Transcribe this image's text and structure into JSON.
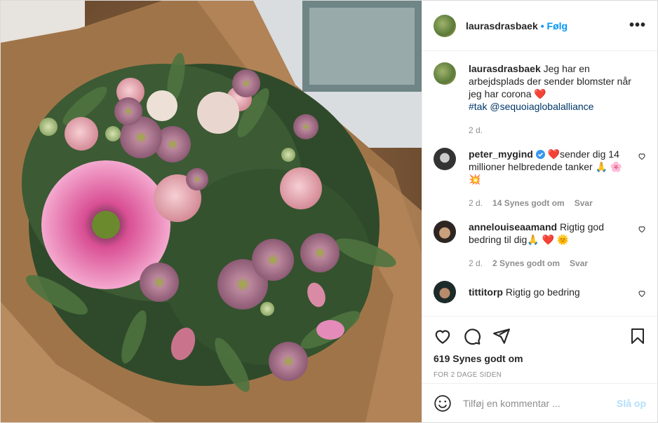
{
  "post": {
    "username": "laurasdrasbaek",
    "follow_label": "• Følg",
    "more_icon": "more-horizontal-icon",
    "photo_alt": "bouquet-photo"
  },
  "caption": {
    "username": "laurasdrasbaek",
    "text": "Jeg har en arbejdsplads der sender blomster når jeg har corona",
    "emoji": "❤️",
    "hashtag": "#tak",
    "mention": "@sequoiaglobalalliance",
    "time": "2 d."
  },
  "comments": [
    {
      "username": "peter_mygind",
      "verified": true,
      "text": "❤️sender dig 14 millioner helbredende tanker 🙏 🌸💥",
      "time": "2 d.",
      "likes": "14 Synes godt om",
      "reply": "Svar"
    },
    {
      "username": "annelouiseaamand",
      "text": "Rigtig god bedring til dig🙏 ❤️ 🌞",
      "time": "2 d.",
      "likes": "2 Synes godt om",
      "reply": "Svar"
    },
    {
      "username": "tittitorp",
      "text": "Rigtig go bedring"
    }
  ],
  "actions": {
    "likes": "619 Synes godt om",
    "posted_ago": "FOR 2 DAGE SIDEN"
  },
  "composer": {
    "placeholder": "Tilføj en kommentar ...",
    "post_label": "Slå op"
  },
  "colors": {
    "link": "#0095f6",
    "hashtag": "#00376b",
    "muted": "#8e8e8e",
    "post_disabled": "#b2dffc",
    "heart": "#ed4956"
  }
}
